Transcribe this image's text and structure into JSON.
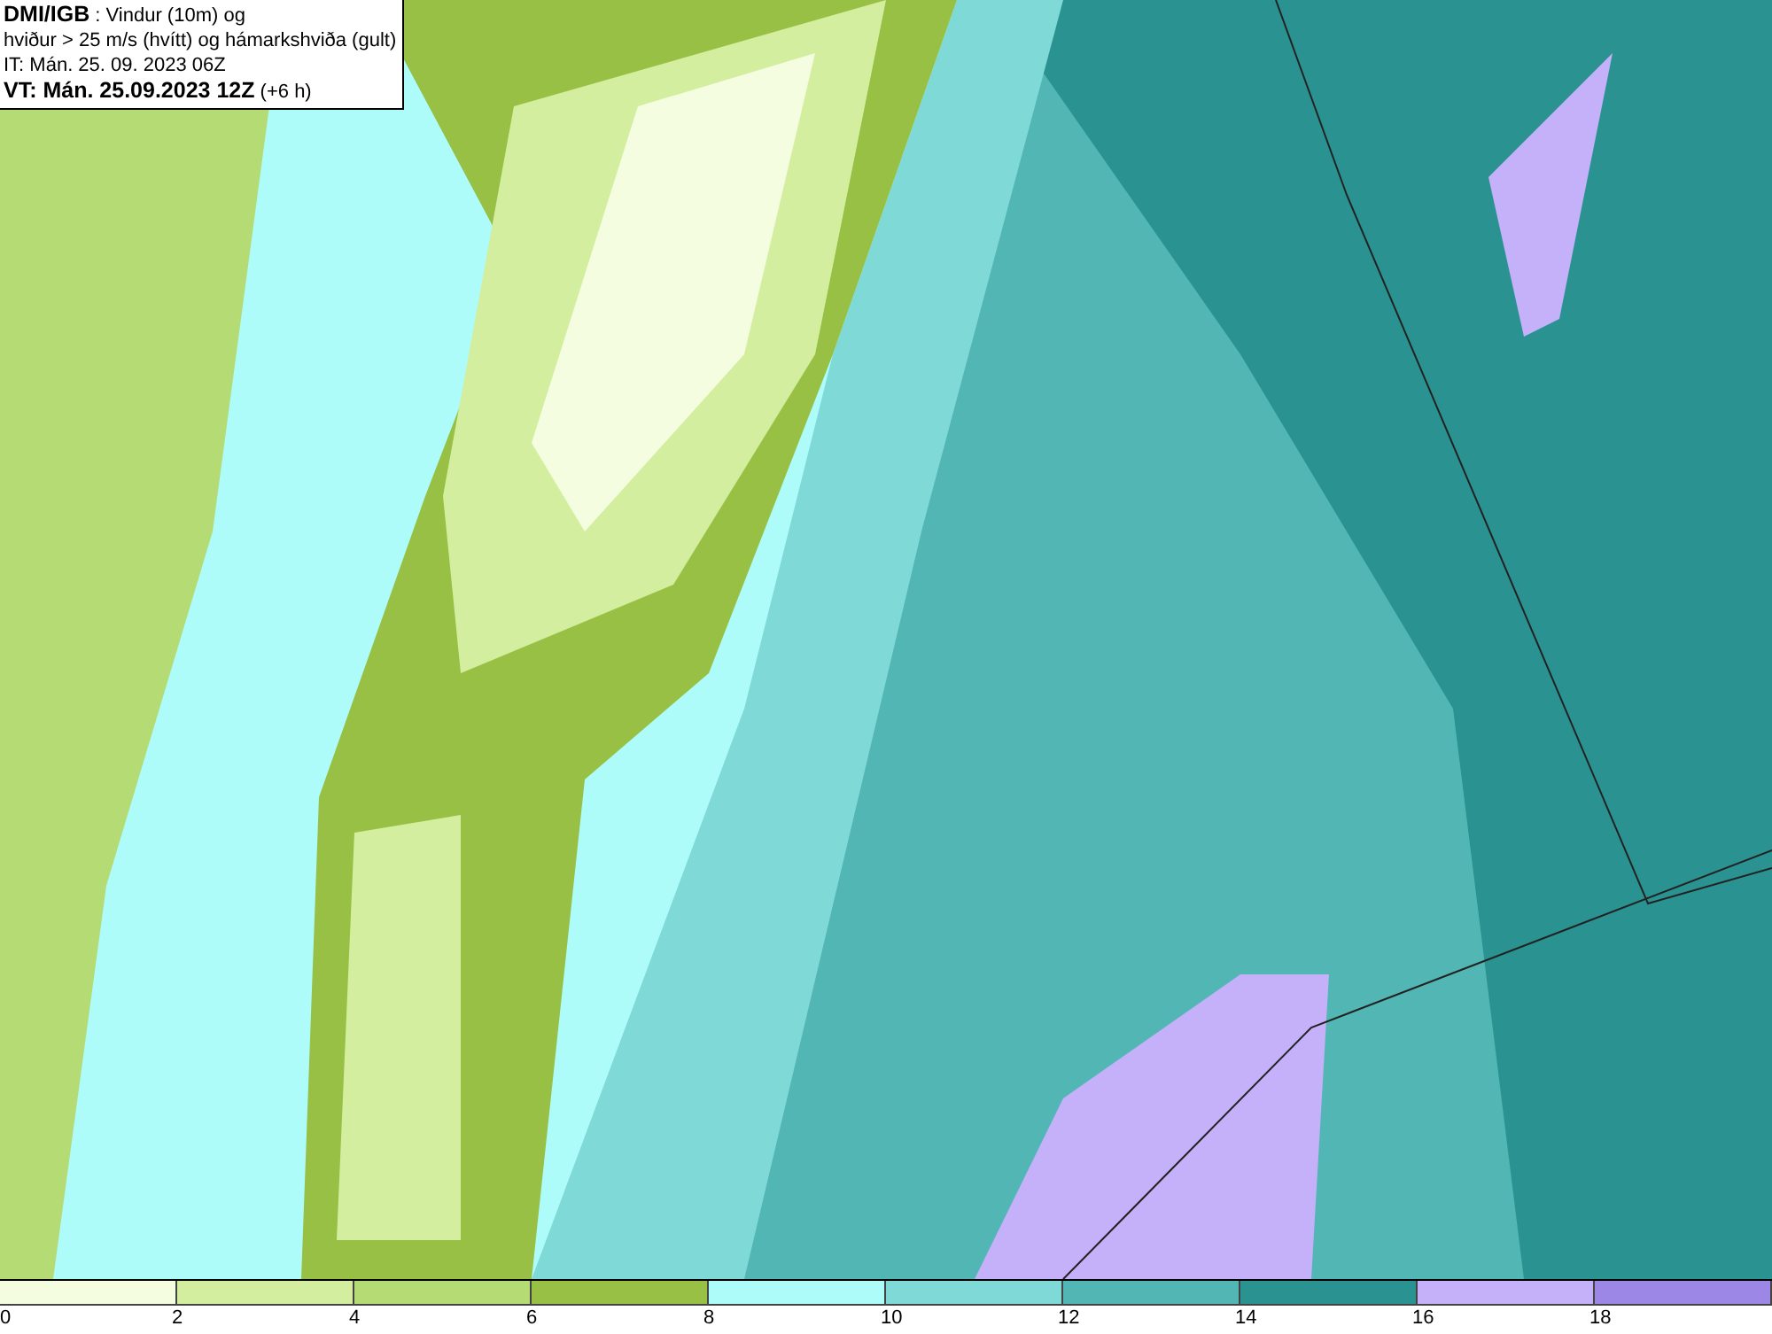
{
  "header": {
    "lines": [
      "**DMI/IGB** : Vindur (10m) og",
      "hviður > 25 m/s (hvítt) og hámarkshviða (gult)",
      "IT: Mán. 25. 09. 2023 06Z",
      "**VT: Mán. 25.09.2023 12Z** (+6 h)"
    ]
  },
  "legend": {
    "bins": [
      {
        "label": "0",
        "color": "#f5fde0"
      },
      {
        "label": "2",
        "color": "#d4eea0"
      },
      {
        "label": "4",
        "color": "#b5db75"
      },
      {
        "label": "6",
        "color": "#98c044"
      },
      {
        "label": "8",
        "color": "#aefcfa"
      },
      {
        "label": "10",
        "color": "#7fd9d7"
      },
      {
        "label": "12",
        "color": "#52b6b4"
      },
      {
        "label": "14",
        "color": "#2a9391"
      },
      {
        "label": "16",
        "color": "#c5b0fa"
      },
      {
        "label": "18",
        "color": "#9c86e6"
      }
    ]
  }
}
